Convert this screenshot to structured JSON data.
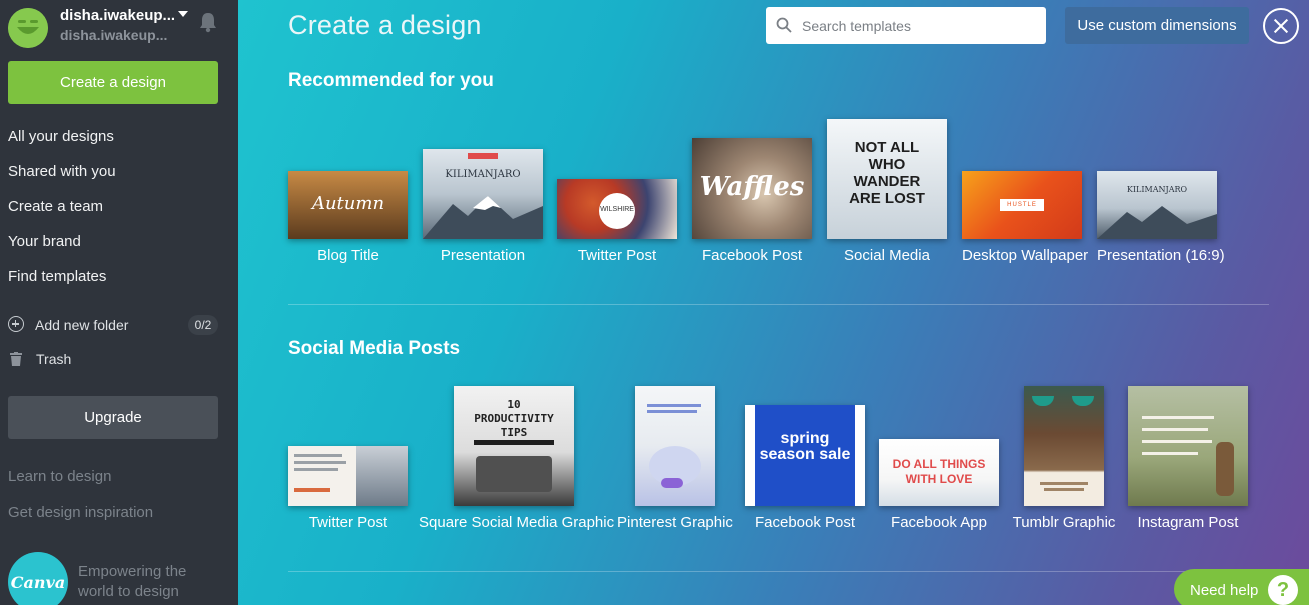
{
  "user": {
    "name": "disha.iwakeup...",
    "email": "disha.iwakeup..."
  },
  "sidebar": {
    "create_label": "Create a design",
    "nav": [
      "All your designs",
      "Shared with you",
      "Create a team",
      "Your brand",
      "Find templates"
    ],
    "add_folder_label": "Add new folder",
    "folder_count": "0/2",
    "trash_label": "Trash",
    "upgrade_label": "Upgrade",
    "learn_label": "Learn to design",
    "inspiration_label": "Get design inspiration",
    "logo_text": "Canva",
    "tagline": "Empowering the world to design"
  },
  "header": {
    "title": "Create a design",
    "search_placeholder": "Search templates",
    "custom_dimensions_label": "Use custom dimensions"
  },
  "recommended": {
    "title": "Recommended for you",
    "items": [
      {
        "caption": "Blog Title",
        "thumb_text": "Autumn",
        "bg": "#6b4a2a"
      },
      {
        "caption": "Presentation",
        "thumb_text": "KILIMANJARO",
        "bg": "#c9d3dc"
      },
      {
        "caption": "Twitter Post",
        "thumb_text": "WILSHIRE",
        "bg": "#b5482d"
      },
      {
        "caption": "Facebook Post",
        "thumb_text": "Waffles",
        "bg": "#7c6a59"
      },
      {
        "caption": "Social Media",
        "thumb_text": "NOT ALL WHO WANDER ARE LOST",
        "bg": "#e9eef2"
      },
      {
        "caption": "Desktop Wallpaper",
        "thumb_text": "HUSTLE",
        "bg": "#ec5a1c"
      },
      {
        "caption": "Presentation (16:9)",
        "thumb_text": "KILIMANJARO",
        "bg": "#c9d3dc"
      }
    ]
  },
  "social": {
    "title": "Social Media Posts",
    "items": [
      {
        "caption": "Twitter Post",
        "thumb_text": "",
        "bg": "#f4f1ec"
      },
      {
        "caption": "Square Social Media Graphic",
        "thumb_text": "10 PRODUCTIVITY TIPS",
        "bg": "#e8e8e8"
      },
      {
        "caption": "Pinterest Graphic",
        "thumb_text": "",
        "bg": "#eef2f6"
      },
      {
        "caption": "Facebook Post",
        "thumb_text": "spring season sale",
        "bg": "#1d4fc4"
      },
      {
        "caption": "Facebook App",
        "thumb_text": "DO ALL THINGS WITH LOVE",
        "bg": "#ffffff"
      },
      {
        "caption": "Tumblr Graphic",
        "thumb_text": "",
        "bg": "#6b4a33"
      },
      {
        "caption": "Instagram Post",
        "thumb_text": "",
        "bg": "#9aa77a"
      }
    ]
  },
  "help": {
    "label": "Need help",
    "q": "?"
  }
}
